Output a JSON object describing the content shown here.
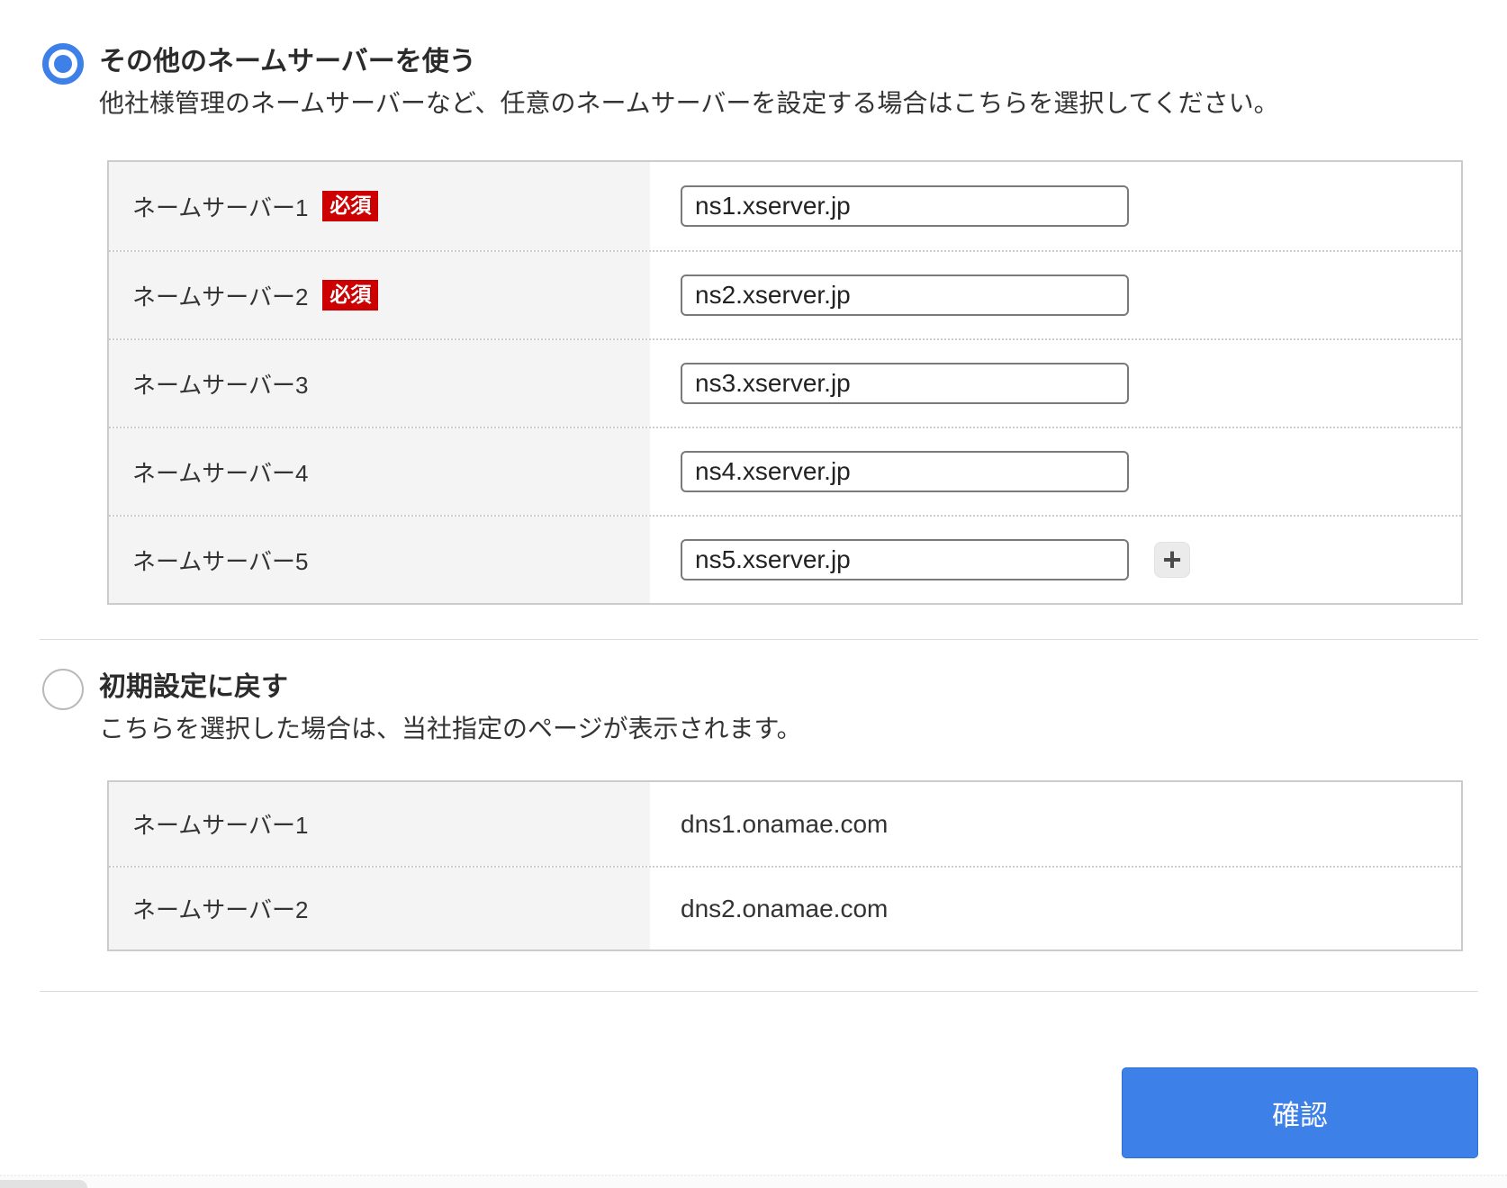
{
  "colors": {
    "accent_blue": "#3d80e8",
    "required_red": "#cc0000"
  },
  "section_other": {
    "radio_selected": true,
    "title": "その他のネームサーバーを使う",
    "description": "他社様管理のネームサーバーなど、任意のネームサーバーを設定する場合はこちらを選択してください。",
    "required_badge": "必須",
    "add_button_label": "+",
    "rows": [
      {
        "label": "ネームサーバー1",
        "required": true,
        "value": "ns1.xserver.jp"
      },
      {
        "label": "ネームサーバー2",
        "required": true,
        "value": "ns2.xserver.jp"
      },
      {
        "label": "ネームサーバー3",
        "required": false,
        "value": "ns3.xserver.jp"
      },
      {
        "label": "ネームサーバー4",
        "required": false,
        "value": "ns4.xserver.jp"
      },
      {
        "label": "ネームサーバー5",
        "required": false,
        "value": "ns5.xserver.jp"
      }
    ]
  },
  "section_default": {
    "radio_selected": false,
    "title": "初期設定に戻す",
    "description": "こちらを選択した場合は、当社指定のページが表示されます。",
    "rows": [
      {
        "label": "ネームサーバー1",
        "value": "dns1.onamae.com"
      },
      {
        "label": "ネームサーバー2",
        "value": "dns2.onamae.com"
      }
    ]
  },
  "confirm_button": {
    "label": "確認"
  }
}
